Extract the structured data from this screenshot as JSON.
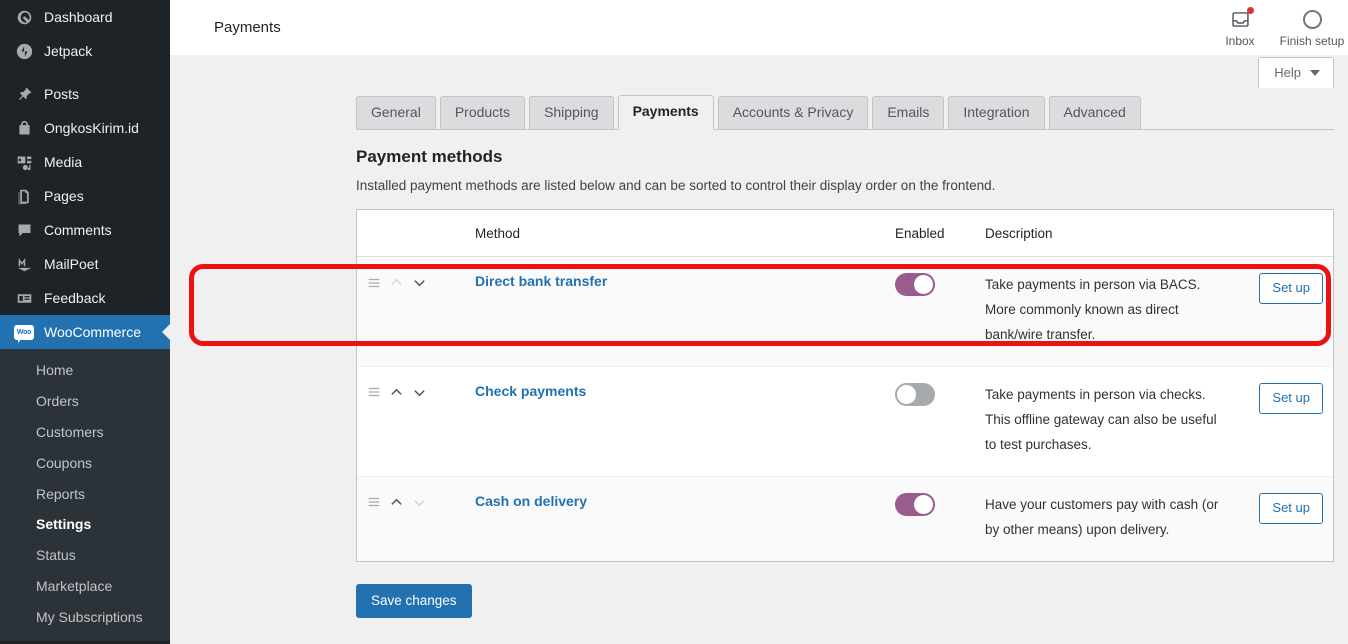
{
  "sidebar": {
    "items": [
      {
        "label": "Dashboard",
        "icon": "dashboard-icon"
      },
      {
        "label": "Jetpack",
        "icon": "jetpack-icon"
      },
      {
        "label": "Posts",
        "icon": "pin-icon"
      },
      {
        "label": "OngkosKirim.id",
        "icon": "bag-icon"
      },
      {
        "label": "Media",
        "icon": "media-icon"
      },
      {
        "label": "Pages",
        "icon": "pages-icon"
      },
      {
        "label": "Comments",
        "icon": "comment-icon"
      },
      {
        "label": "MailPoet",
        "icon": "mailpoet-icon"
      },
      {
        "label": "Feedback",
        "icon": "feedback-icon"
      }
    ],
    "current": {
      "label": "WooCommerce",
      "logo_text": "Woo"
    },
    "submenu": [
      {
        "label": "Home",
        "active": false
      },
      {
        "label": "Orders",
        "active": false
      },
      {
        "label": "Customers",
        "active": false
      },
      {
        "label": "Coupons",
        "active": false
      },
      {
        "label": "Reports",
        "active": false
      },
      {
        "label": "Settings",
        "active": true
      },
      {
        "label": "Status",
        "active": false
      },
      {
        "label": "Marketplace",
        "active": false
      },
      {
        "label": "My Subscriptions",
        "active": false
      }
    ]
  },
  "topbar": {
    "title": "Payments",
    "inbox_label": "Inbox",
    "inbox_icon": "inbox-icon",
    "finish_setup_label": "Finish setup",
    "finish_setup_icon": "progress-circle-icon"
  },
  "help": {
    "label": "Help",
    "icon": "chevron-down-icon"
  },
  "tabs": [
    {
      "label": "General",
      "active": false
    },
    {
      "label": "Products",
      "active": false
    },
    {
      "label": "Shipping",
      "active": false
    },
    {
      "label": "Payments",
      "active": true
    },
    {
      "label": "Accounts & Privacy",
      "active": false
    },
    {
      "label": "Emails",
      "active": false
    },
    {
      "label": "Integration",
      "active": false
    },
    {
      "label": "Advanced",
      "active": false
    }
  ],
  "section": {
    "title": "Payment methods",
    "description": "Installed payment methods are listed below and can be sorted to control their display order on the frontend."
  },
  "table": {
    "headers": {
      "sort": "",
      "method": "Method",
      "enabled": "Enabled",
      "description": "Description",
      "action": ""
    },
    "rows": [
      {
        "name": "Direct bank transfer",
        "enabled": true,
        "description": "Take payments in person via BACS. More commonly known as direct bank/wire transfer.",
        "action_label": "Set up",
        "up_disabled": true,
        "down_disabled": false,
        "highlighted": true
      },
      {
        "name": "Check payments",
        "enabled": false,
        "description": "Take payments in person via checks. This offline gateway can also be useful to test purchases.",
        "action_label": "Set up",
        "up_disabled": false,
        "down_disabled": false,
        "highlighted": false
      },
      {
        "name": "Cash on delivery",
        "enabled": true,
        "description": "Have your customers pay with cash (or by other means) upon delivery.",
        "action_label": "Set up",
        "up_disabled": false,
        "down_disabled": true,
        "highlighted": false
      }
    ]
  },
  "footer": {
    "save_label": "Save changes"
  },
  "colors": {
    "wp_blue": "#2271b1",
    "sidebar_bg": "#1d2327",
    "submenu_bg": "#2c3338",
    "toggle_on": "#9a5b8f",
    "toggle_off": "#a7aaad",
    "annotation": "#ee1111",
    "badge_red": "#d63638"
  }
}
